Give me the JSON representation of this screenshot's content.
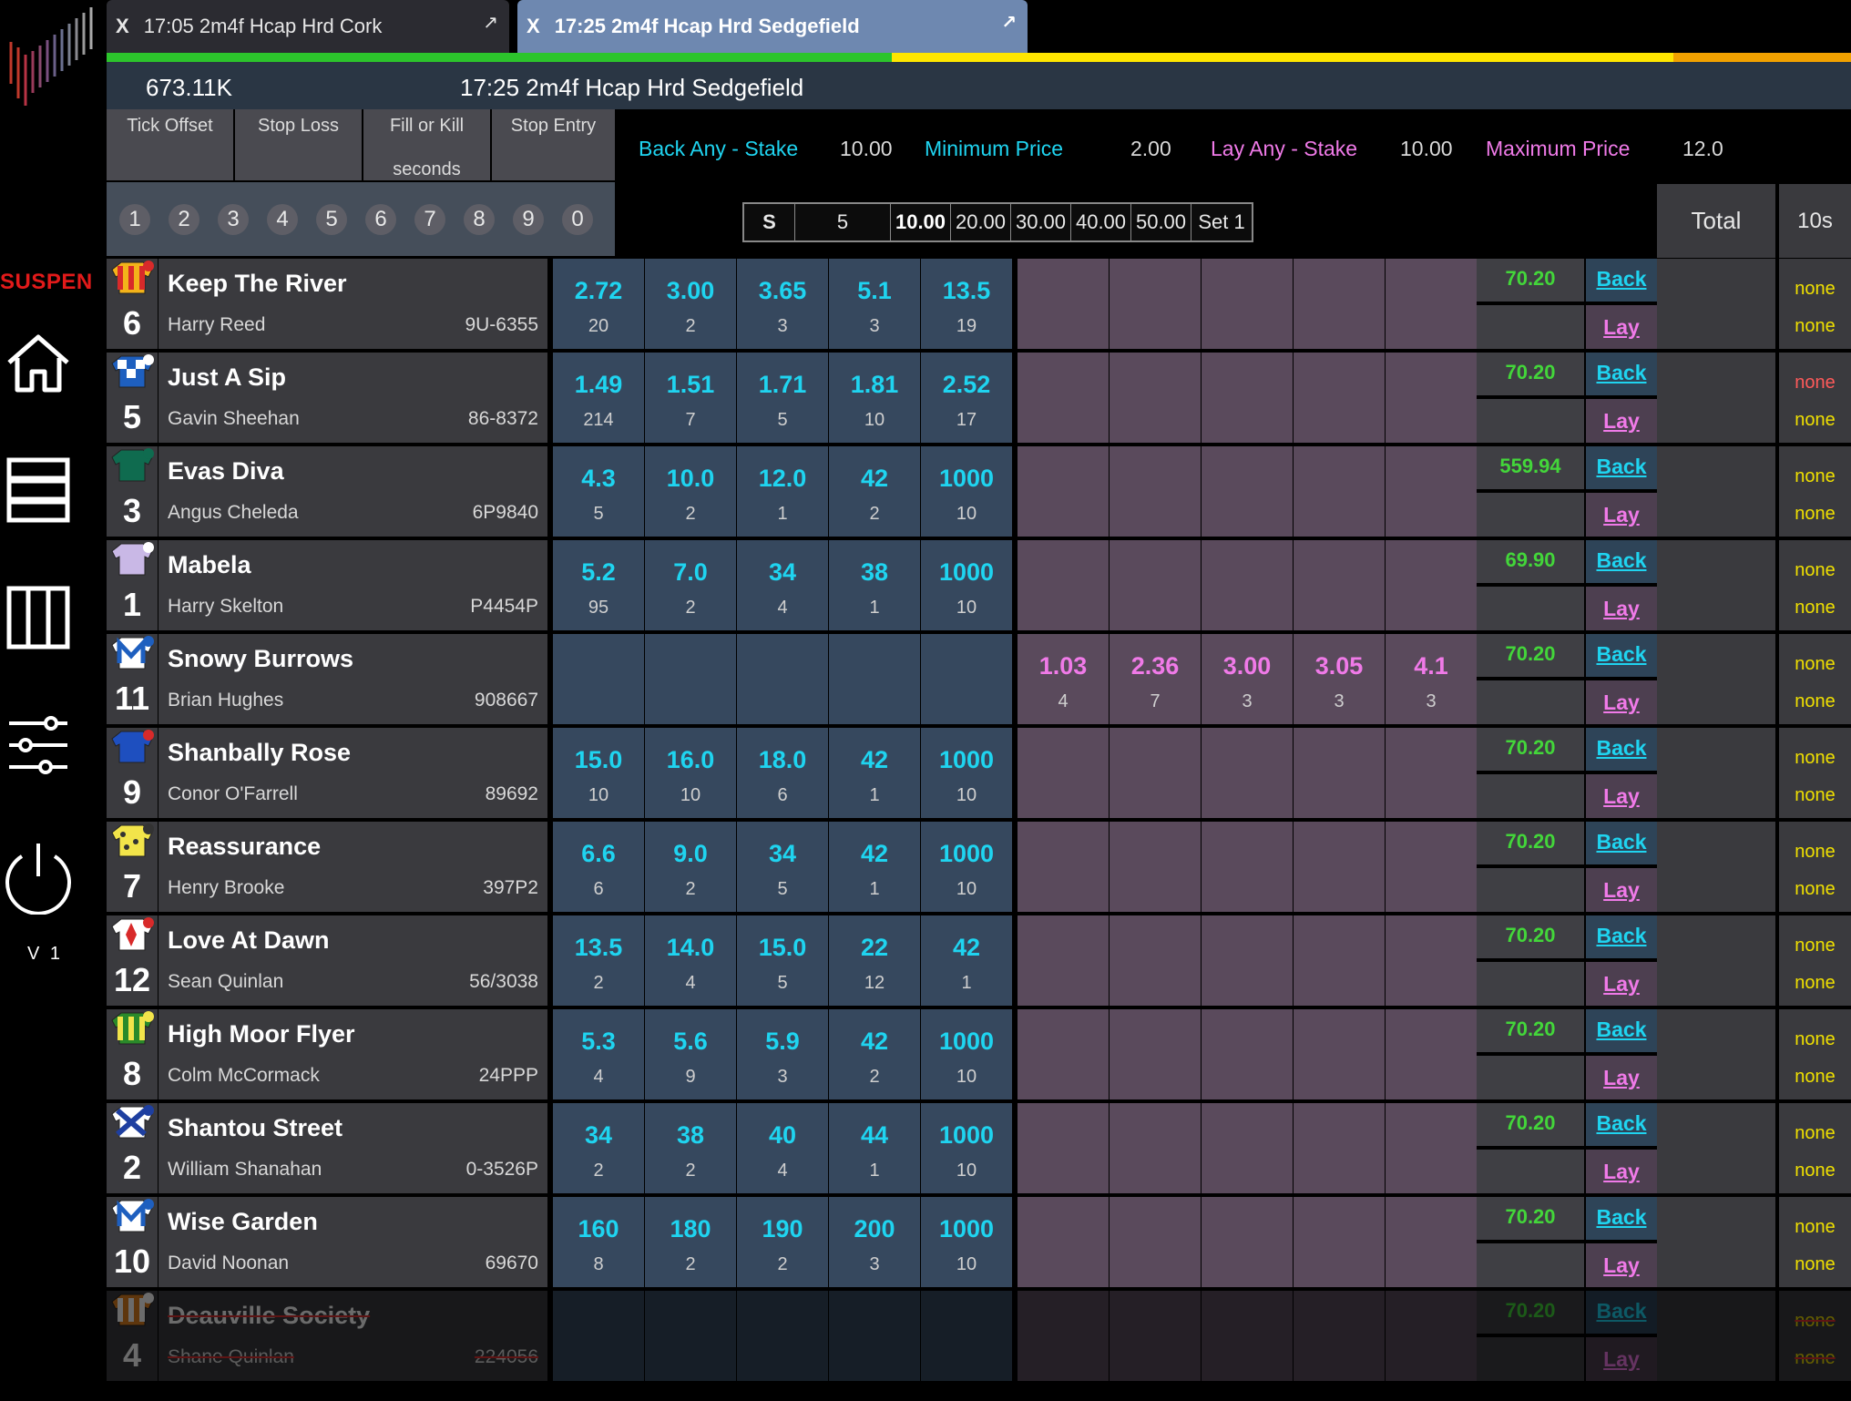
{
  "sidebar": {
    "status": "SUSPEN",
    "version": "V 1",
    "icons": [
      "home-icon",
      "rows-icon",
      "columns-icon",
      "sliders-icon",
      "power-icon"
    ]
  },
  "tabs": [
    {
      "close": "X",
      "label": "17:05 2m4f Hcap Hrd Cork",
      "active": false
    },
    {
      "close": "X",
      "label": "17:25 2m4f Hcap Hrd Sedgefield",
      "active": true
    }
  ],
  "header": {
    "matched": "673.11K",
    "market": "17:25 2m4f Hcap Hrd Sedgefield"
  },
  "controls": {
    "tick_offset": "Tick Offset",
    "stop_loss": "Stop Loss",
    "fill_or_kill": "Fill or Kill",
    "fill_or_kill_sub": "seconds",
    "stop_entry": "Stop Entry",
    "numkeys": [
      "1",
      "2",
      "3",
      "4",
      "5",
      "6",
      "7",
      "8",
      "9",
      "0"
    ],
    "back_any_label": "Back Any - Stake",
    "back_any_value": "10.00",
    "min_price_label": "Minimum Price",
    "min_price_value": "2.00",
    "lay_any_label": "Lay Any - Stake",
    "lay_any_value": "10.00",
    "max_price_label": "Maximum Price",
    "max_price_value": "12.0",
    "stakes": [
      "S",
      "5",
      "10.00",
      "20.00",
      "30.00",
      "40.00",
      "50.00",
      "Set 1"
    ],
    "total_label": "Total",
    "tens_label": "10s"
  },
  "colors": {
    "back": "#1fd4f0",
    "lay": "#f07ae8",
    "profit": "#43d63a",
    "suspended": "#e21a1a"
  },
  "runners": [
    {
      "num": "6",
      "name": "Keep The River",
      "jockey": "Harry Reed",
      "form": "9U-6355",
      "back": [
        [
          "2.72",
          "20"
        ],
        [
          "3.00",
          "2"
        ],
        [
          "3.65",
          "3"
        ],
        [
          "5.1",
          "3"
        ],
        [
          "13.5",
          "19"
        ]
      ],
      "lay": [],
      "profit": "70.20",
      "back_label": "Back",
      "lay_label": "Lay",
      "n1": "none",
      "n2": "none",
      "n1red": false
    },
    {
      "num": "5",
      "name": "Just A Sip",
      "jockey": "Gavin Sheehan",
      "form": "86-8372",
      "back": [
        [
          "1.49",
          "214"
        ],
        [
          "1.51",
          "7"
        ],
        [
          "1.71",
          "5"
        ],
        [
          "1.81",
          "10"
        ],
        [
          "2.52",
          "17"
        ]
      ],
      "lay": [],
      "profit": "70.20",
      "back_label": "Back",
      "lay_label": "Lay",
      "n1": "none",
      "n2": "none",
      "n1red": true
    },
    {
      "num": "3",
      "name": "Evas Diva",
      "jockey": "Angus Cheleda",
      "form": "6P9840",
      "back": [
        [
          "4.3",
          "5"
        ],
        [
          "10.0",
          "2"
        ],
        [
          "12.0",
          "1"
        ],
        [
          "42",
          "2"
        ],
        [
          "1000",
          "10"
        ]
      ],
      "lay": [],
      "profit": "559.94",
      "back_label": "Back",
      "lay_label": "Lay",
      "n1": "none",
      "n2": "none",
      "n1red": false
    },
    {
      "num": "1",
      "name": "Mabela",
      "jockey": "Harry Skelton",
      "form": "P4454P",
      "back": [
        [
          "5.2",
          "95"
        ],
        [
          "7.0",
          "2"
        ],
        [
          "34",
          "4"
        ],
        [
          "38",
          "1"
        ],
        [
          "1000",
          "10"
        ]
      ],
      "lay": [],
      "profit": "69.90",
      "back_label": "Back",
      "lay_label": "Lay",
      "n1": "none",
      "n2": "none",
      "n1red": false
    },
    {
      "num": "11",
      "name": "Snowy Burrows",
      "jockey": "Brian Hughes",
      "form": "908667",
      "back": [],
      "lay": [
        [
          "1.03",
          "4"
        ],
        [
          "2.36",
          "7"
        ],
        [
          "3.00",
          "3"
        ],
        [
          "3.05",
          "3"
        ],
        [
          "4.1",
          "3"
        ]
      ],
      "profit": "70.20",
      "back_label": "Back",
      "lay_label": "Lay",
      "n1": "none",
      "n2": "none",
      "n1red": false
    },
    {
      "num": "9",
      "name": "Shanbally Rose",
      "jockey": "Conor O'Farrell",
      "form": "89692",
      "back": [
        [
          "15.0",
          "10"
        ],
        [
          "16.0",
          "10"
        ],
        [
          "18.0",
          "6"
        ],
        [
          "42",
          "1"
        ],
        [
          "1000",
          "10"
        ]
      ],
      "lay": [],
      "profit": "70.20",
      "back_label": "Back",
      "lay_label": "Lay",
      "n1": "none",
      "n2": "none",
      "n1red": false
    },
    {
      "num": "7",
      "name": "Reassurance",
      "jockey": "Henry Brooke",
      "form": "397P2",
      "back": [
        [
          "6.6",
          "6"
        ],
        [
          "9.0",
          "2"
        ],
        [
          "34",
          "5"
        ],
        [
          "42",
          "1"
        ],
        [
          "1000",
          "10"
        ]
      ],
      "lay": [],
      "profit": "70.20",
      "back_label": "Back",
      "lay_label": "Lay",
      "n1": "none",
      "n2": "none",
      "n1red": false
    },
    {
      "num": "12",
      "name": "Love At Dawn",
      "jockey": "Sean Quinlan",
      "form": "56/3038",
      "back": [
        [
          "13.5",
          "2"
        ],
        [
          "14.0",
          "4"
        ],
        [
          "15.0",
          "5"
        ],
        [
          "22",
          "12"
        ],
        [
          "42",
          "1"
        ]
      ],
      "lay": [],
      "profit": "70.20",
      "back_label": "Back",
      "lay_label": "Lay",
      "n1": "none",
      "n2": "none",
      "n1red": false
    },
    {
      "num": "8",
      "name": "High Moor Flyer",
      "jockey": "Colm McCormack",
      "form": "24PPP",
      "back": [
        [
          "5.3",
          "4"
        ],
        [
          "5.6",
          "9"
        ],
        [
          "5.9",
          "3"
        ],
        [
          "42",
          "2"
        ],
        [
          "1000",
          "10"
        ]
      ],
      "lay": [],
      "profit": "70.20",
      "back_label": "Back",
      "lay_label": "Lay",
      "n1": "none",
      "n2": "none",
      "n1red": false
    },
    {
      "num": "2",
      "name": "Shantou Street",
      "jockey": "William Shanahan",
      "form": "0-3526P",
      "back": [
        [
          "34",
          "2"
        ],
        [
          "38",
          "2"
        ],
        [
          "40",
          "4"
        ],
        [
          "44",
          "1"
        ],
        [
          "1000",
          "10"
        ]
      ],
      "lay": [],
      "profit": "70.20",
      "back_label": "Back",
      "lay_label": "Lay",
      "n1": "none",
      "n2": "none",
      "n1red": false
    },
    {
      "num": "10",
      "name": "Wise Garden",
      "jockey": "David Noonan",
      "form": "69670",
      "back": [
        [
          "160",
          "8"
        ],
        [
          "180",
          "2"
        ],
        [
          "190",
          "2"
        ],
        [
          "200",
          "3"
        ],
        [
          "1000",
          "10"
        ]
      ],
      "lay": [],
      "profit": "70.20",
      "back_label": "Back",
      "lay_label": "Lay",
      "n1": "none",
      "n2": "none",
      "n1red": false
    },
    {
      "num": "4",
      "name": "Deauville Society",
      "jockey": "Shane Quinlan",
      "form": "224056",
      "back": [],
      "lay": [],
      "profit": "70.20",
      "back_label": "Back",
      "lay_label": "Lay",
      "n1": "none",
      "n2": "none",
      "n1red": false,
      "removed": true
    }
  ]
}
